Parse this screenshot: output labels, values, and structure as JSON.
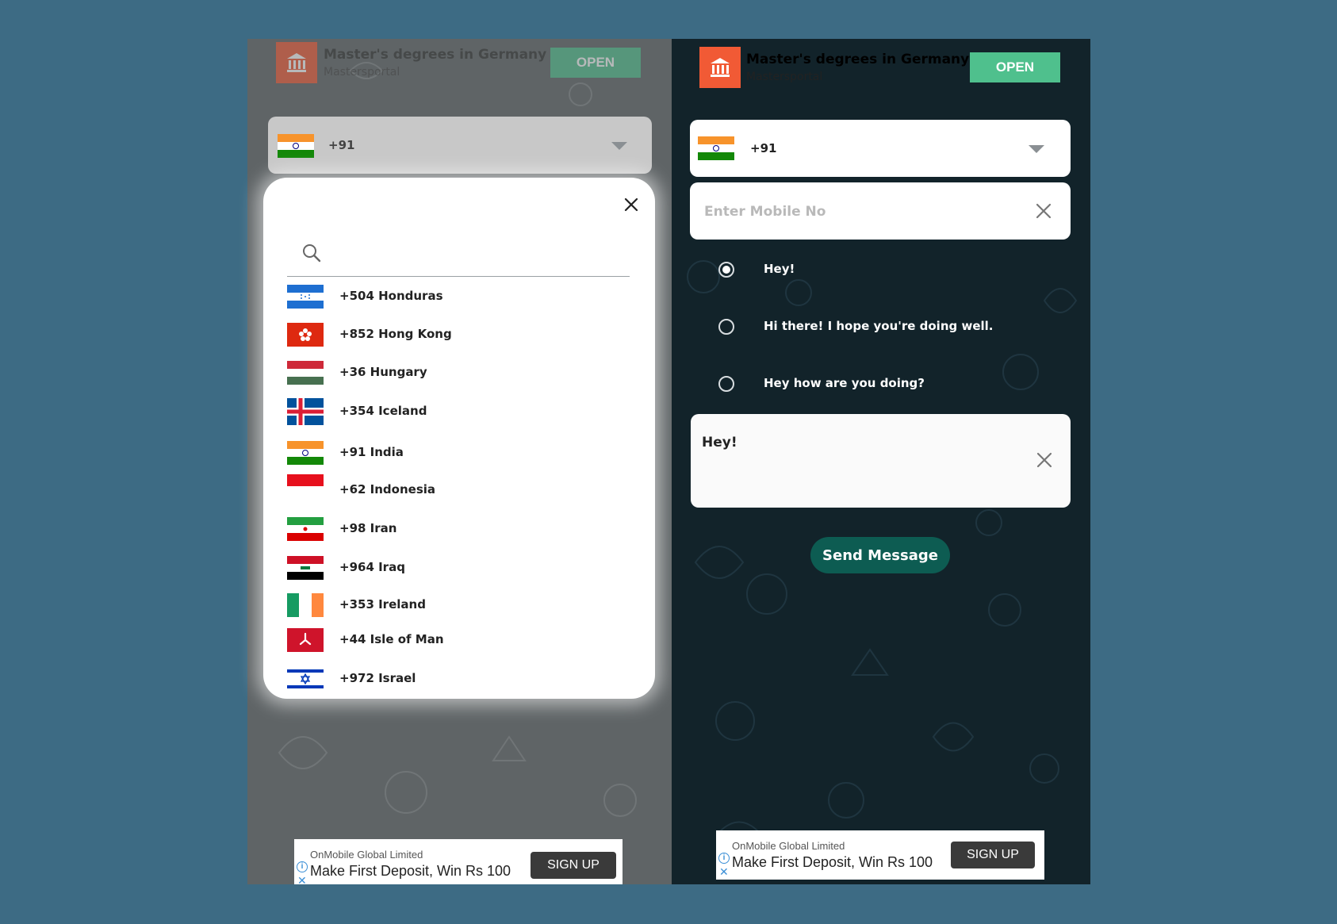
{
  "ad_banner": {
    "title": "Master's degrees in Germany",
    "subtitle": "Mastersportal",
    "open_label": "OPEN"
  },
  "country_select": {
    "selected_code": "+91",
    "selected_country": "India"
  },
  "country_modal": {
    "search_placeholder": "",
    "countries": [
      {
        "label": "+504 Honduras",
        "flag": "honduras"
      },
      {
        "label": "+852 Hong Kong",
        "flag": "hong-kong"
      },
      {
        "label": "+36 Hungary",
        "flag": "hungary"
      },
      {
        "label": "+354 Iceland",
        "flag": "iceland"
      },
      {
        "label": "+91 India",
        "flag": "india"
      },
      {
        "label": "+62 Indonesia",
        "flag": "indonesia"
      },
      {
        "label": "+98 Iran",
        "flag": "iran"
      },
      {
        "label": "+964 Iraq",
        "flag": "iraq"
      },
      {
        "label": "+353 Ireland",
        "flag": "ireland"
      },
      {
        "label": "+44 Isle of Man",
        "flag": "isle-of-man"
      },
      {
        "label": "+972 Israel",
        "flag": "israel"
      }
    ]
  },
  "form": {
    "mobile_placeholder": "Enter Mobile No",
    "mobile_value": "",
    "templates": [
      {
        "label": "Hey!",
        "checked": true
      },
      {
        "label": "Hi there! I hope you're doing well.",
        "checked": false
      },
      {
        "label": "Hey how are you doing?",
        "checked": false
      }
    ],
    "message_text": "Hey!",
    "send_label": "Send Message"
  },
  "bottom_ad": {
    "company": "OnMobile Global Limited",
    "headline": "Make First Deposit, Win Rs 100",
    "cta": "SIGN UP"
  },
  "colors": {
    "page_background": "#3d6b84",
    "open_button": "#4fc08d",
    "ad_logo": "#f15a35",
    "send_button": "#0d5c52",
    "right_background": "#12232a"
  }
}
